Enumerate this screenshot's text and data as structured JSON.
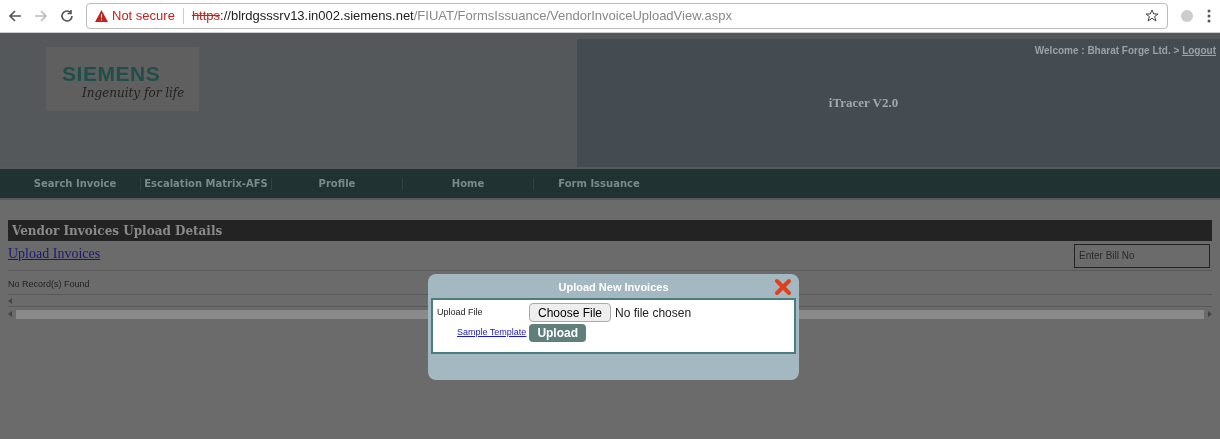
{
  "browser": {
    "security": "Not secure",
    "url_scheme": "https",
    "url_host": "://blrdgsssrv13.in002.siemens.net",
    "url_path": "/FIUAT/FormsIssuance/VendorInvoiceUploadView.aspx"
  },
  "header": {
    "logo_word": "SIEMENS",
    "logo_tagline": "Ingenuity for life",
    "app_title": "iTracer V2.0",
    "welcome": "Welcome : Bharat Forge Ltd. >",
    "logout": "Logout"
  },
  "nav": [
    {
      "label": "Search Invoice"
    },
    {
      "label": "Escalation Matrix-AFS"
    },
    {
      "label": "Profile"
    },
    {
      "label": "Home"
    },
    {
      "label": "Form Issuance"
    }
  ],
  "section_title": "Vendor Invoices Upload Details",
  "upload_link": "Upload Invoices",
  "bill_search": {
    "placeholder": "Enter Bill No"
  },
  "empty_message": "No Record(s) Found",
  "dialog": {
    "title": "Upload New Invoices",
    "file_label": "Upload File",
    "choose_button": "Choose File",
    "file_status": "No file chosen",
    "template_link": "Sample Template",
    "upload_button": "Upload"
  }
}
